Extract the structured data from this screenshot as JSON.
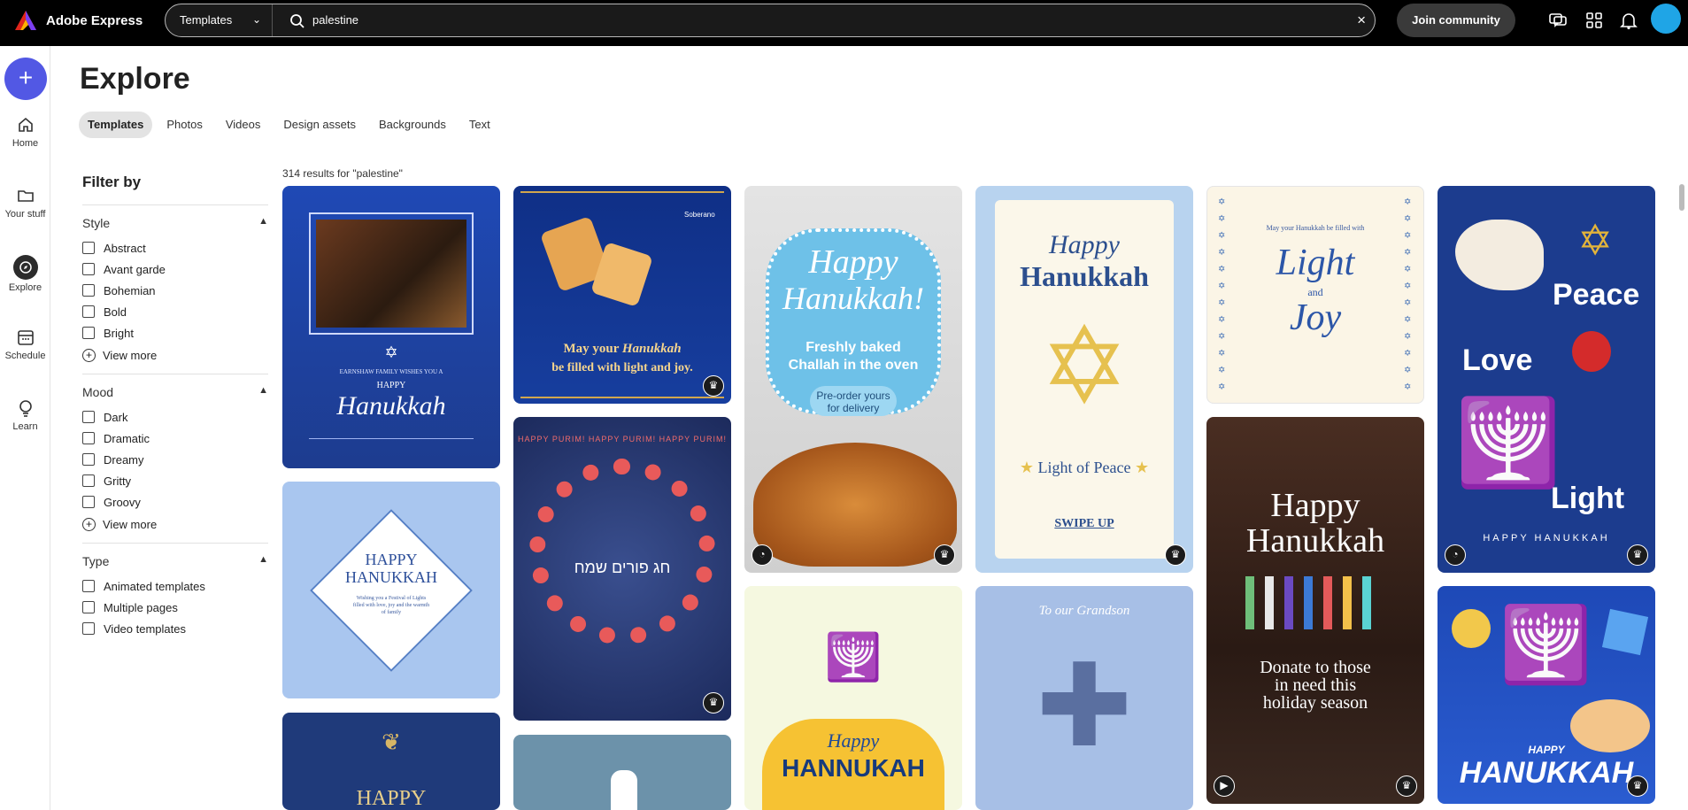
{
  "app": {
    "name": "Adobe Express"
  },
  "search": {
    "scope": "Templates",
    "query": "palestine"
  },
  "header": {
    "join_label": "Join community"
  },
  "rail": [
    {
      "label": "Home"
    },
    {
      "label": "Your stuff"
    },
    {
      "label": "Explore"
    },
    {
      "label": "Schedule"
    },
    {
      "label": "Learn"
    }
  ],
  "page": {
    "title": "Explore"
  },
  "tabs": [
    "Templates",
    "Photos",
    "Videos",
    "Design assets",
    "Backgrounds",
    "Text"
  ],
  "filters": {
    "title": "Filter by",
    "view_more": "View more",
    "sections": [
      {
        "title": "Style",
        "options": [
          "Abstract",
          "Avant garde",
          "Bohemian",
          "Bold",
          "Bright"
        ],
        "has_view_more": true
      },
      {
        "title": "Mood",
        "options": [
          "Dark",
          "Dramatic",
          "Dreamy",
          "Gritty",
          "Groovy"
        ],
        "has_view_more": true
      },
      {
        "title": "Type",
        "options": [
          "Animated templates",
          "Multiple pages",
          "Video templates"
        ],
        "has_view_more": false
      }
    ]
  },
  "results": {
    "text": "314 results for \"palestine\""
  },
  "cards": {
    "c1": {
      "l1": "EARNSHAW FAMILY WISHES YOU A",
      "l2": "HAPPY",
      "l3": "Hanukkah"
    },
    "c2": {
      "l1": "HAPPY",
      "l2": "HANUKKAH",
      "l3": "Wishing you a Festival of Lights filled with love, joy and the warmth of family"
    },
    "c3": {
      "l1": "HAPPY"
    },
    "c4": {
      "l1": "May your",
      "l2": "Hanukkah",
      "l3": "be filled with light and joy.",
      "brand": "Soberano"
    },
    "c5": {
      "ring": "HAPPY PURIM! HAPPY PURIM! HAPPY PURIM!",
      "center": "חג פורים שמח"
    },
    "c7": {
      "l1": "Happy",
      "l2": "Hanukkah!",
      "l3": "Freshly baked",
      "l4": "Challah in the oven",
      "l5": "Pre-order yours",
      "l6": "for delivery"
    },
    "c8": {
      "l1": "Happy",
      "l2": "HANNUKAH"
    },
    "c9": {
      "l1": "Happy",
      "l2": "Hanukkah",
      "l3": "Light of Peace",
      "l4": "SWIPE UP"
    },
    "c10": {
      "l1": "To our Grandson"
    },
    "c11": {
      "l1": "May your Hanukkah be filled with",
      "l2": "Light",
      "l3": "and",
      "l4": "Joy"
    },
    "c12": {
      "l1": "Happy",
      "l2": "Hanukkah",
      "l3": "Donate to those",
      "l4": "in need this",
      "l5": "holiday season"
    },
    "c13": {
      "l1": "Peace",
      "l2": "Love",
      "l3": "Light",
      "l4": "HAPPY HANUKKAH"
    },
    "c14": {
      "l1": "HAPPY",
      "l2": "HANUKKAH"
    }
  },
  "colors": {
    "accent": "#5258e4",
    "topbar": "#000000",
    "avatar": "#1fa5e6"
  }
}
